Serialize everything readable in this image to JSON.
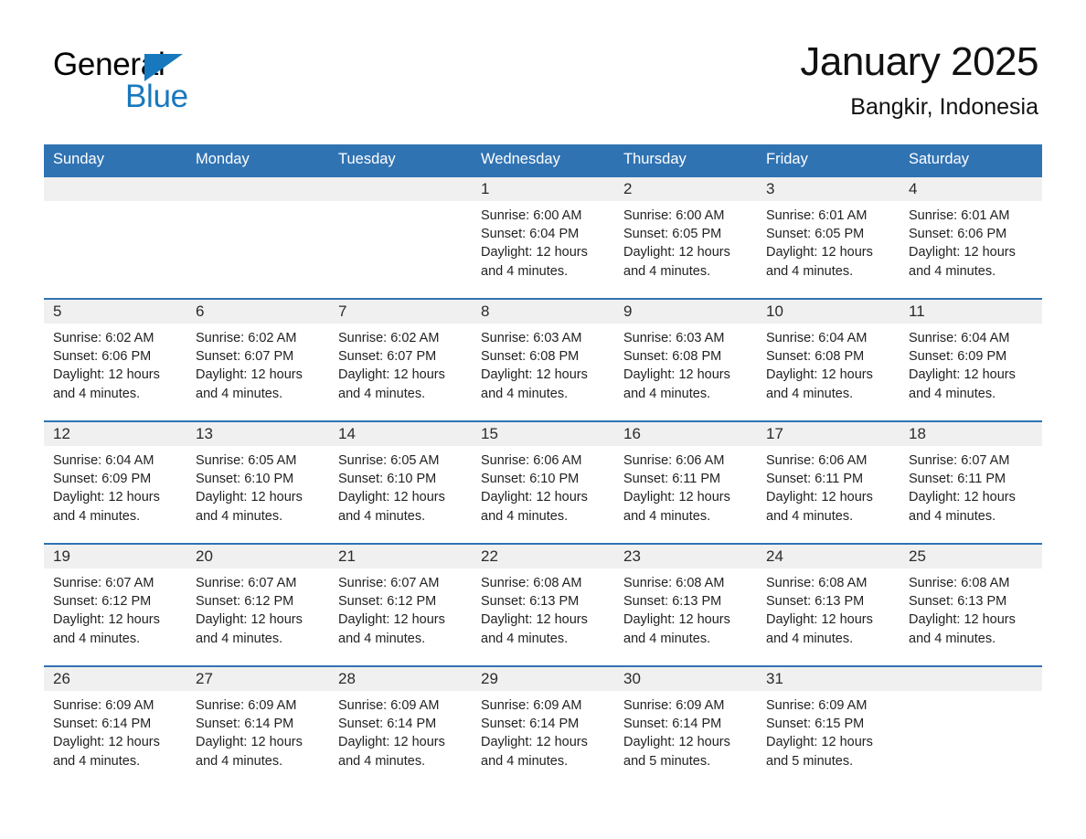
{
  "brand": {
    "name_part1": "General",
    "name_part2": "Blue",
    "accent_color": "#1878bd",
    "triangle_icon": "brand-triangle-icon"
  },
  "header": {
    "title": "January 2025",
    "location": "Bangkir, Indonesia"
  },
  "theme": {
    "header_blue": "#3073b3",
    "daynum_background": "#f0f0f0",
    "page_background": "#ffffff"
  },
  "weekdays": [
    "Sunday",
    "Monday",
    "Tuesday",
    "Wednesday",
    "Thursday",
    "Friday",
    "Saturday"
  ],
  "weeks": [
    [
      {
        "day": "",
        "sunrise": "",
        "sunset": "",
        "daylight": "",
        "daylight2": "",
        "empty": true
      },
      {
        "day": "",
        "sunrise": "",
        "sunset": "",
        "daylight": "",
        "daylight2": "",
        "empty": true
      },
      {
        "day": "",
        "sunrise": "",
        "sunset": "",
        "daylight": "",
        "daylight2": "",
        "empty": true
      },
      {
        "day": "1",
        "sunrise": "Sunrise: 6:00 AM",
        "sunset": "Sunset: 6:04 PM",
        "daylight": "Daylight: 12 hours",
        "daylight2": "and 4 minutes.",
        "empty": false
      },
      {
        "day": "2",
        "sunrise": "Sunrise: 6:00 AM",
        "sunset": "Sunset: 6:05 PM",
        "daylight": "Daylight: 12 hours",
        "daylight2": "and 4 minutes.",
        "empty": false
      },
      {
        "day": "3",
        "sunrise": "Sunrise: 6:01 AM",
        "sunset": "Sunset: 6:05 PM",
        "daylight": "Daylight: 12 hours",
        "daylight2": "and 4 minutes.",
        "empty": false
      },
      {
        "day": "4",
        "sunrise": "Sunrise: 6:01 AM",
        "sunset": "Sunset: 6:06 PM",
        "daylight": "Daylight: 12 hours",
        "daylight2": "and 4 minutes.",
        "empty": false
      }
    ],
    [
      {
        "day": "5",
        "sunrise": "Sunrise: 6:02 AM",
        "sunset": "Sunset: 6:06 PM",
        "daylight": "Daylight: 12 hours",
        "daylight2": "and 4 minutes.",
        "empty": false
      },
      {
        "day": "6",
        "sunrise": "Sunrise: 6:02 AM",
        "sunset": "Sunset: 6:07 PM",
        "daylight": "Daylight: 12 hours",
        "daylight2": "and 4 minutes.",
        "empty": false
      },
      {
        "day": "7",
        "sunrise": "Sunrise: 6:02 AM",
        "sunset": "Sunset: 6:07 PM",
        "daylight": "Daylight: 12 hours",
        "daylight2": "and 4 minutes.",
        "empty": false
      },
      {
        "day": "8",
        "sunrise": "Sunrise: 6:03 AM",
        "sunset": "Sunset: 6:08 PM",
        "daylight": "Daylight: 12 hours",
        "daylight2": "and 4 minutes.",
        "empty": false
      },
      {
        "day": "9",
        "sunrise": "Sunrise: 6:03 AM",
        "sunset": "Sunset: 6:08 PM",
        "daylight": "Daylight: 12 hours",
        "daylight2": "and 4 minutes.",
        "empty": false
      },
      {
        "day": "10",
        "sunrise": "Sunrise: 6:04 AM",
        "sunset": "Sunset: 6:08 PM",
        "daylight": "Daylight: 12 hours",
        "daylight2": "and 4 minutes.",
        "empty": false
      },
      {
        "day": "11",
        "sunrise": "Sunrise: 6:04 AM",
        "sunset": "Sunset: 6:09 PM",
        "daylight": "Daylight: 12 hours",
        "daylight2": "and 4 minutes.",
        "empty": false
      }
    ],
    [
      {
        "day": "12",
        "sunrise": "Sunrise: 6:04 AM",
        "sunset": "Sunset: 6:09 PM",
        "daylight": "Daylight: 12 hours",
        "daylight2": "and 4 minutes.",
        "empty": false
      },
      {
        "day": "13",
        "sunrise": "Sunrise: 6:05 AM",
        "sunset": "Sunset: 6:10 PM",
        "daylight": "Daylight: 12 hours",
        "daylight2": "and 4 minutes.",
        "empty": false
      },
      {
        "day": "14",
        "sunrise": "Sunrise: 6:05 AM",
        "sunset": "Sunset: 6:10 PM",
        "daylight": "Daylight: 12 hours",
        "daylight2": "and 4 minutes.",
        "empty": false
      },
      {
        "day": "15",
        "sunrise": "Sunrise: 6:06 AM",
        "sunset": "Sunset: 6:10 PM",
        "daylight": "Daylight: 12 hours",
        "daylight2": "and 4 minutes.",
        "empty": false
      },
      {
        "day": "16",
        "sunrise": "Sunrise: 6:06 AM",
        "sunset": "Sunset: 6:11 PM",
        "daylight": "Daylight: 12 hours",
        "daylight2": "and 4 minutes.",
        "empty": false
      },
      {
        "day": "17",
        "sunrise": "Sunrise: 6:06 AM",
        "sunset": "Sunset: 6:11 PM",
        "daylight": "Daylight: 12 hours",
        "daylight2": "and 4 minutes.",
        "empty": false
      },
      {
        "day": "18",
        "sunrise": "Sunrise: 6:07 AM",
        "sunset": "Sunset: 6:11 PM",
        "daylight": "Daylight: 12 hours",
        "daylight2": "and 4 minutes.",
        "empty": false
      }
    ],
    [
      {
        "day": "19",
        "sunrise": "Sunrise: 6:07 AM",
        "sunset": "Sunset: 6:12 PM",
        "daylight": "Daylight: 12 hours",
        "daylight2": "and 4 minutes.",
        "empty": false
      },
      {
        "day": "20",
        "sunrise": "Sunrise: 6:07 AM",
        "sunset": "Sunset: 6:12 PM",
        "daylight": "Daylight: 12 hours",
        "daylight2": "and 4 minutes.",
        "empty": false
      },
      {
        "day": "21",
        "sunrise": "Sunrise: 6:07 AM",
        "sunset": "Sunset: 6:12 PM",
        "daylight": "Daylight: 12 hours",
        "daylight2": "and 4 minutes.",
        "empty": false
      },
      {
        "day": "22",
        "sunrise": "Sunrise: 6:08 AM",
        "sunset": "Sunset: 6:13 PM",
        "daylight": "Daylight: 12 hours",
        "daylight2": "and 4 minutes.",
        "empty": false
      },
      {
        "day": "23",
        "sunrise": "Sunrise: 6:08 AM",
        "sunset": "Sunset: 6:13 PM",
        "daylight": "Daylight: 12 hours",
        "daylight2": "and 4 minutes.",
        "empty": false
      },
      {
        "day": "24",
        "sunrise": "Sunrise: 6:08 AM",
        "sunset": "Sunset: 6:13 PM",
        "daylight": "Daylight: 12 hours",
        "daylight2": "and 4 minutes.",
        "empty": false
      },
      {
        "day": "25",
        "sunrise": "Sunrise: 6:08 AM",
        "sunset": "Sunset: 6:13 PM",
        "daylight": "Daylight: 12 hours",
        "daylight2": "and 4 minutes.",
        "empty": false
      }
    ],
    [
      {
        "day": "26",
        "sunrise": "Sunrise: 6:09 AM",
        "sunset": "Sunset: 6:14 PM",
        "daylight": "Daylight: 12 hours",
        "daylight2": "and 4 minutes.",
        "empty": false
      },
      {
        "day": "27",
        "sunrise": "Sunrise: 6:09 AM",
        "sunset": "Sunset: 6:14 PM",
        "daylight": "Daylight: 12 hours",
        "daylight2": "and 4 minutes.",
        "empty": false
      },
      {
        "day": "28",
        "sunrise": "Sunrise: 6:09 AM",
        "sunset": "Sunset: 6:14 PM",
        "daylight": "Daylight: 12 hours",
        "daylight2": "and 4 minutes.",
        "empty": false
      },
      {
        "day": "29",
        "sunrise": "Sunrise: 6:09 AM",
        "sunset": "Sunset: 6:14 PM",
        "daylight": "Daylight: 12 hours",
        "daylight2": "and 4 minutes.",
        "empty": false
      },
      {
        "day": "30",
        "sunrise": "Sunrise: 6:09 AM",
        "sunset": "Sunset: 6:14 PM",
        "daylight": "Daylight: 12 hours",
        "daylight2": "and 5 minutes.",
        "empty": false
      },
      {
        "day": "31",
        "sunrise": "Sunrise: 6:09 AM",
        "sunset": "Sunset: 6:15 PM",
        "daylight": "Daylight: 12 hours",
        "daylight2": "and 5 minutes.",
        "empty": false
      },
      {
        "day": "",
        "sunrise": "",
        "sunset": "",
        "daylight": "",
        "daylight2": "",
        "empty": true
      }
    ]
  ]
}
